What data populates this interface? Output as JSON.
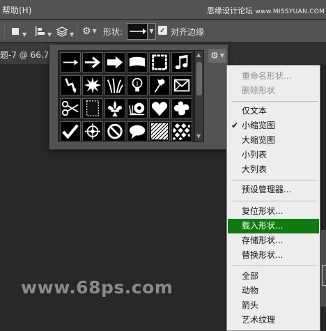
{
  "menubar": {
    "help_label": "帮助(H)",
    "watermark_top": "思缘设计论坛",
    "watermark_top_url": "www.MISSYUAN.COM"
  },
  "options": {
    "shape_label": "形状:",
    "align_edges_label": "对齐边缘",
    "align_edges_checked": true
  },
  "document": {
    "tab_title": "题-7 @ 66.7%"
  },
  "shape_picker": {
    "icons": [
      "arrow-thin-icon",
      "arrow-bold-icon",
      "arrow-block-icon",
      "banner-icon",
      "frame-icon",
      "music-note-icon",
      "lightning-icon",
      "starburst-icon",
      "grass-icon",
      "lightbulb-icon",
      "pushpin-icon",
      "envelope-icon",
      "scissors-icon",
      "stamp-frame-icon",
      "fleur-de-lis-icon",
      "snail-icon",
      "heart-icon",
      "ink-blot-icon",
      "checkmark-icon",
      "target-icon",
      "no-sign-icon",
      "speech-bubble-icon",
      "hatch-pattern-icon",
      "checker-pattern-icon"
    ]
  },
  "menu": {
    "items": [
      {
        "label": "重命名形状...",
        "disabled": true
      },
      {
        "label": "删除形状",
        "disabled": true
      },
      {
        "label": "仅文本"
      },
      {
        "label": "小缩览图",
        "checked": true
      },
      {
        "label": "大缩览图"
      },
      {
        "label": "小列表"
      },
      {
        "label": "大列表"
      },
      {
        "label": "预设管理器..."
      },
      {
        "label": "复位形状..."
      },
      {
        "label": "载入形状...",
        "highlighted": true
      },
      {
        "label": "存储形状..."
      },
      {
        "label": "替换形状..."
      },
      {
        "label": "全部"
      },
      {
        "label": "动物"
      },
      {
        "label": "箭头"
      },
      {
        "label": "艺术纹理"
      }
    ]
  },
  "watermark": "www.68ps.com",
  "colors": {
    "highlight": "#107c10",
    "menu_bg": "#ededed",
    "toolbar_bg": "#535353",
    "canvas_bg": "#282828"
  }
}
